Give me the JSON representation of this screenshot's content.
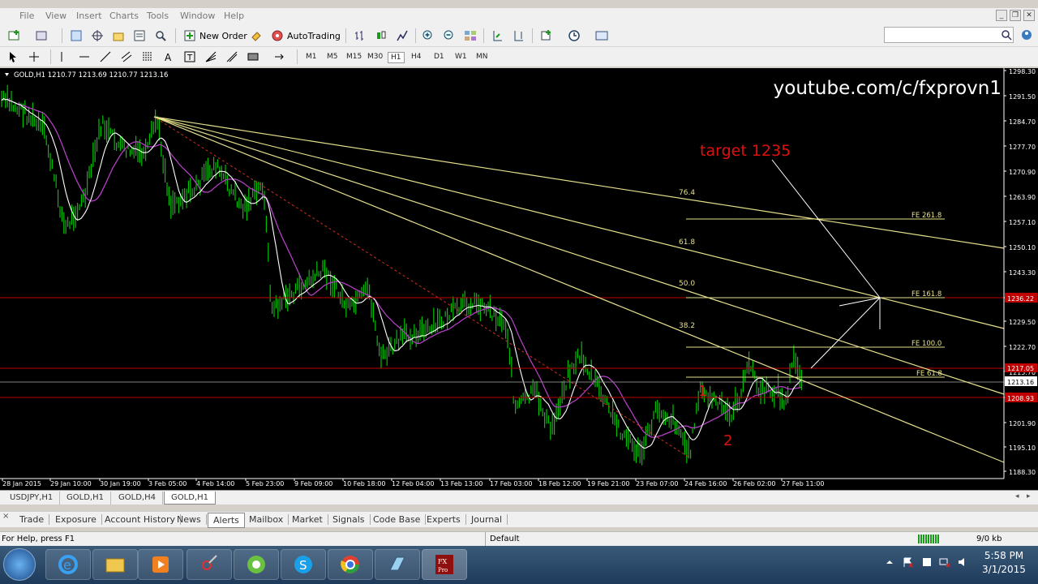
{
  "menu": [
    "File",
    "View",
    "Insert",
    "Charts",
    "Tools",
    "Window",
    "Help"
  ],
  "toolbar": {
    "new_order": "New Order",
    "autotrading": "AutoTrading"
  },
  "timeframes": [
    "M1",
    "M5",
    "M15",
    "M30",
    "H1",
    "H4",
    "D1",
    "W1",
    "MN"
  ],
  "active_timeframe": "H1",
  "chart": {
    "header": "GOLD,H1  1210.77 1213.69 1210.77 1213.16",
    "watermark": "youtube.com/c/fxprovn1",
    "target_label": "target 1235",
    "wave_labels": [
      "1",
      "2"
    ],
    "fib_fan_levels": [
      "76.4",
      "61.8",
      "50.0",
      "38.2"
    ],
    "fe_levels": [
      "FE 261.8",
      "FE 161.8",
      "FE 100.0",
      "FE 61.8"
    ],
    "price_axis": [
      "1298.30",
      "1291.50",
      "1284.70",
      "1277.70",
      "1270.90",
      "1263.90",
      "1257.10",
      "1250.10",
      "1243.30",
      "1236.20",
      "1229.50",
      "1222.70",
      "1215.70",
      "1213.16",
      "1208.90",
      "1201.90",
      "1195.10",
      "1188.30"
    ],
    "time_axis": [
      "28 Jan 2015",
      "29 Jan 10:00",
      "30 Jan 19:00",
      "3 Feb 05:00",
      "4 Feb 14:00",
      "5 Feb 23:00",
      "9 Feb 09:00",
      "10 Feb 18:00",
      "12 Feb 04:00",
      "13 Feb 13:00",
      "17 Feb 03:00",
      "18 Feb 12:00",
      "19 Feb 21:00",
      "23 Feb 07:00",
      "24 Feb 16:00",
      "26 Feb 02:00",
      "27 Feb 11:00"
    ],
    "price_tags": {
      "red_top": "1236.22",
      "red_mid": "1217.05",
      "current": "1213.16",
      "red_low": "1208.93"
    },
    "colors": {
      "background": "#000000",
      "bars": "#00c000",
      "ma_fast": "#ffffff",
      "ma_slow": "#b040c0",
      "fan": "#e6e08c",
      "horizontal_red": "#c00000",
      "text_red": "#e01010"
    }
  },
  "symbol_tabs": [
    "USDJPY,H1",
    "GOLD,H1",
    "GOLD,H4",
    "GOLD,H1"
  ],
  "active_symbol_tab": 3,
  "terminal_tabs": [
    "Trade",
    "Exposure",
    "Account History",
    "News",
    "Alerts",
    "Mailbox",
    "Market",
    "Signals",
    "Code Base",
    "Experts",
    "Journal"
  ],
  "active_terminal_tab": "Alerts",
  "status": {
    "help": "For Help, press F1",
    "profile": "Default",
    "traffic": "9/0 kb"
  },
  "clock": {
    "time": "5:58 PM",
    "date": "3/1/2015"
  }
}
